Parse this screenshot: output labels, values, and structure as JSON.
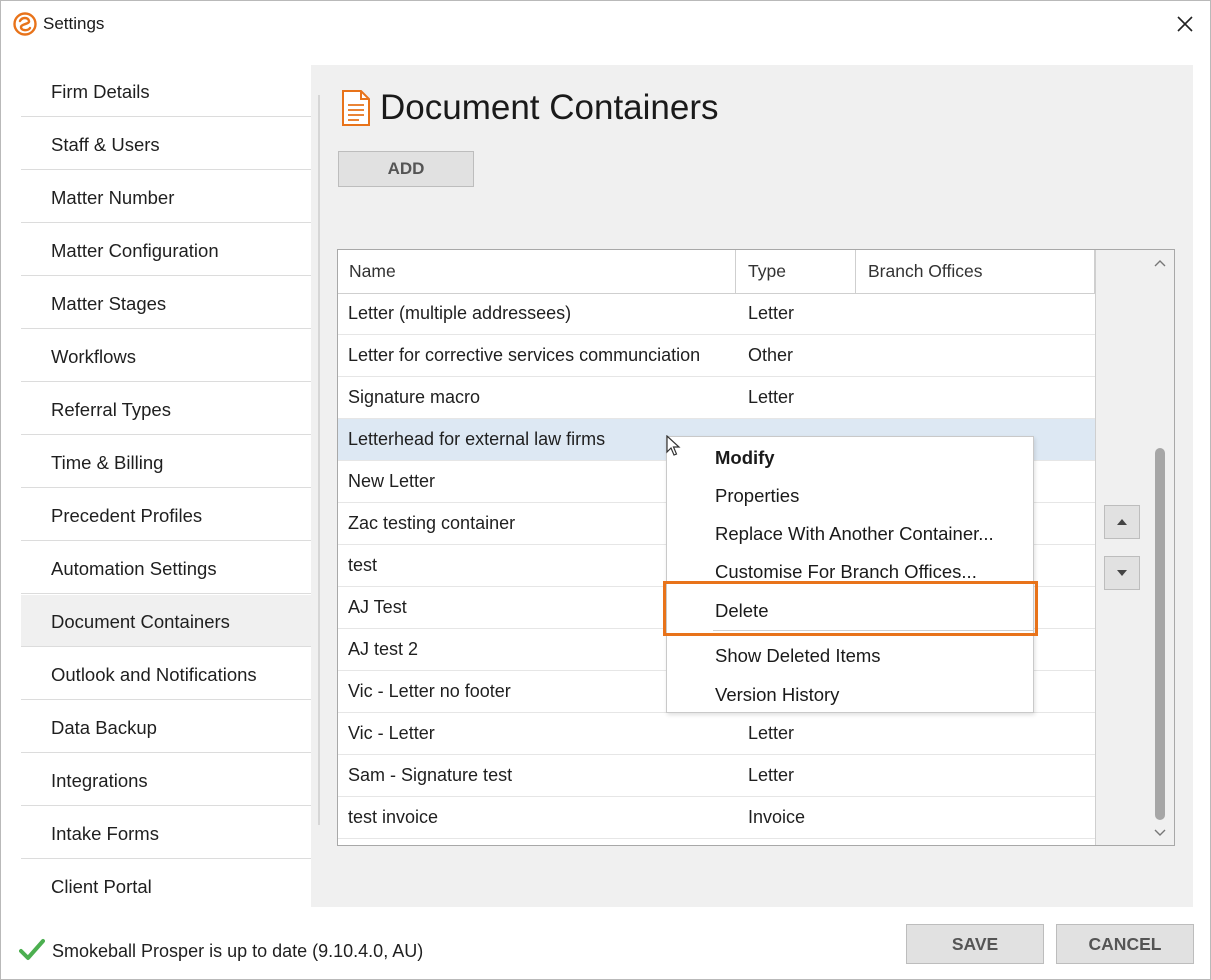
{
  "window": {
    "title": "Settings",
    "logo_icon": "smokeball-logo-icon",
    "close_icon": "close-icon"
  },
  "sidebar": {
    "items": [
      {
        "label": "Firm Details"
      },
      {
        "label": "Staff & Users"
      },
      {
        "label": "Matter Number"
      },
      {
        "label": "Matter Configuration"
      },
      {
        "label": "Matter Stages"
      },
      {
        "label": "Workflows"
      },
      {
        "label": "Referral Types"
      },
      {
        "label": "Time & Billing"
      },
      {
        "label": "Precedent Profiles"
      },
      {
        "label": "Automation Settings"
      },
      {
        "label": "Document Containers",
        "active": true
      },
      {
        "label": "Outlook and Notifications"
      },
      {
        "label": "Data Backup"
      },
      {
        "label": "Integrations"
      },
      {
        "label": "Intake Forms"
      },
      {
        "label": "Client Portal"
      }
    ]
  },
  "main": {
    "title": "Document Containers",
    "title_icon": "document-icon",
    "add_label": "ADD"
  },
  "grid": {
    "columns": [
      "Name",
      "Type",
      "Branch Offices"
    ],
    "rows": [
      {
        "name": "Letter (multiple addressees)",
        "type": "Letter",
        "branch": ""
      },
      {
        "name": "Letter for corrective services communciation",
        "type": "Other",
        "branch": ""
      },
      {
        "name": "Signature macro",
        "type": "Letter",
        "branch": ""
      },
      {
        "name": "Letterhead for external law firms",
        "type": "",
        "branch": "",
        "selected": true
      },
      {
        "name": "New Letter",
        "type": "",
        "branch": ""
      },
      {
        "name": "Zac testing container",
        "type": "",
        "branch": ""
      },
      {
        "name": "test",
        "type": "",
        "branch": ""
      },
      {
        "name": "AJ Test",
        "type": "",
        "branch": ""
      },
      {
        "name": "AJ test 2",
        "type": "",
        "branch": ""
      },
      {
        "name": "Vic - Letter no footer",
        "type": "",
        "branch": ""
      },
      {
        "name": "Vic - Letter",
        "type": "Letter",
        "branch": ""
      },
      {
        "name": "Sam - Signature test",
        "type": "Letter",
        "branch": ""
      },
      {
        "name": "test invoice",
        "type": "Invoice",
        "branch": ""
      }
    ]
  },
  "context_menu": {
    "items": [
      {
        "label": "Modify",
        "bold": true
      },
      {
        "label": "Properties"
      },
      {
        "label": "Replace With Another Container..."
      },
      {
        "label": "Customise For Branch Offices..."
      },
      {
        "label": "Delete",
        "highlighted": true
      },
      {
        "label": "Show Deleted Items"
      },
      {
        "label": "Version History"
      }
    ],
    "highlight_color": "#e8731a"
  },
  "footer": {
    "status_text": "Smokeball Prosper is up to date (9.10.4.0, AU)",
    "status_icon": "checkmark-icon",
    "status_color": "#4caf50",
    "save_label": "SAVE",
    "cancel_label": "CANCEL"
  },
  "colors": {
    "accent": "#e8731a",
    "selected_row": "#dde8f3",
    "panel_bg": "#f0f0f0"
  }
}
